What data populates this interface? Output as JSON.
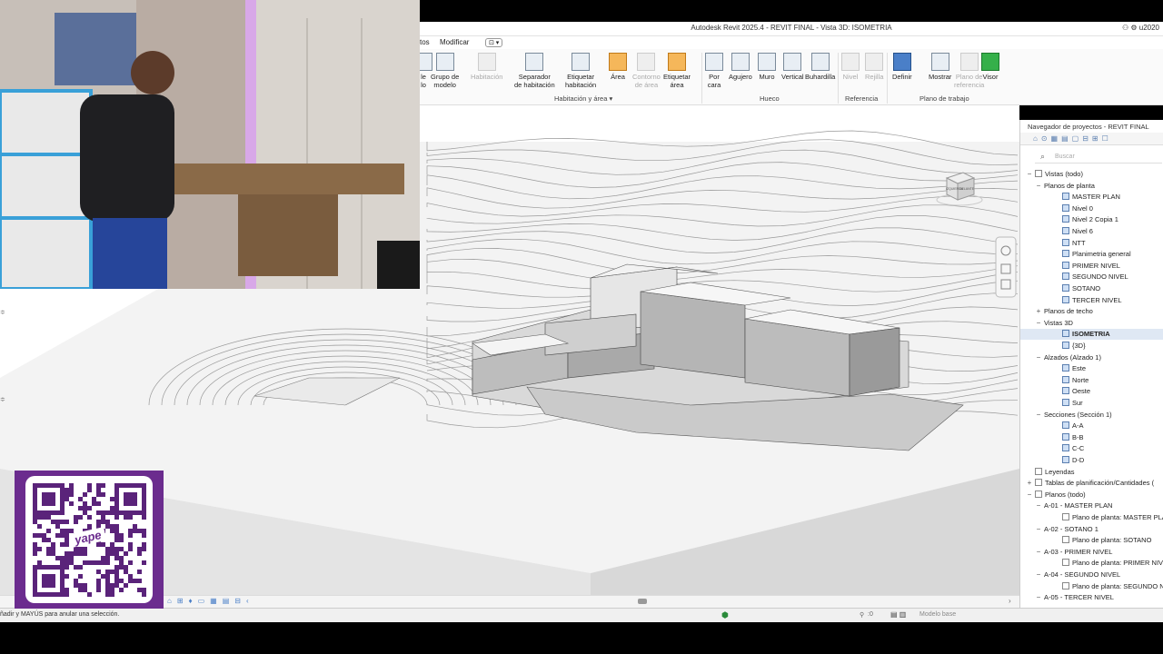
{
  "app": {
    "title": "Autodesk Revit 2025.4 - REVIT FINAL - Vista 3D: ISOMETRIA",
    "user": "u2020"
  },
  "menu": {
    "items": [
      "tos",
      "Modificar"
    ]
  },
  "ribbon": {
    "buttons": [
      {
        "label": "le",
        "label2": "lo",
        "icon": "component-icon",
        "disabled": false
      },
      {
        "label": "Grupo de",
        "label2": "modelo",
        "icon": "model-group-icon",
        "disabled": false
      },
      {
        "label": "Habitación",
        "label2": "",
        "icon": "room-icon",
        "disabled": true
      },
      {
        "label": "Separador",
        "label2": "de habitación",
        "icon": "room-separator-icon",
        "disabled": false
      },
      {
        "label": "Etiquetar",
        "label2": "habitación",
        "icon": "tag-room-icon",
        "disabled": false
      },
      {
        "label": "Área",
        "label2": "",
        "icon": "area-icon",
        "disabled": false
      },
      {
        "label": "Contorno",
        "label2": "de área",
        "icon": "area-boundary-icon",
        "disabled": true
      },
      {
        "label": "Etiquetar",
        "label2": "área",
        "icon": "tag-area-icon",
        "disabled": false
      },
      {
        "label": "Por",
        "label2": "cara",
        "icon": "by-face-icon",
        "disabled": false
      },
      {
        "label": "Agujero",
        "label2": "",
        "icon": "shaft-icon",
        "disabled": false
      },
      {
        "label": "Muro",
        "label2": "",
        "icon": "wall-opening-icon",
        "disabled": false
      },
      {
        "label": "Vertical",
        "label2": "",
        "icon": "vertical-opening-icon",
        "disabled": false
      },
      {
        "label": "Buhardilla",
        "label2": "",
        "icon": "dormer-icon",
        "disabled": false
      },
      {
        "label": "Nivel",
        "label2": "",
        "icon": "level-icon",
        "disabled": true
      },
      {
        "label": "Rejilla",
        "label2": "",
        "icon": "grid-icon",
        "disabled": true
      },
      {
        "label": "Definir",
        "label2": "",
        "icon": "set-workplane-icon",
        "disabled": false
      },
      {
        "label": "Mostrar",
        "label2": "",
        "icon": "show-workplane-icon",
        "disabled": false
      },
      {
        "label": "Plano de",
        "label2": "referencia",
        "icon": "ref-plane-icon",
        "disabled": true
      },
      {
        "label": "Visor",
        "label2": "",
        "icon": "viewer-icon",
        "disabled": false
      }
    ],
    "groups": [
      "Habitación y área ▾",
      "Hueco",
      "Referencia",
      "Plano de trabajo"
    ]
  },
  "viewcube": {
    "left": "IZQUIERDA",
    "front": "DELANTE"
  },
  "project_browser": {
    "title": "Navegador de proyectos - REVIT FINAL",
    "search_placeholder": "Buscar",
    "tree": [
      {
        "label": "Vistas (todo)",
        "toggle": "−",
        "kind": "root"
      },
      {
        "label": "Planos de planta",
        "toggle": "−",
        "kind": "group"
      },
      {
        "label": "MASTER PLAN",
        "kind": "view"
      },
      {
        "label": "Nivel 0",
        "kind": "view"
      },
      {
        "label": "Nivel 2 Copia 1",
        "kind": "view"
      },
      {
        "label": "Nivel 6",
        "kind": "view"
      },
      {
        "label": "NTT",
        "kind": "view"
      },
      {
        "label": "Planimetria general",
        "kind": "view"
      },
      {
        "label": "PRIMER NIVEL",
        "kind": "view"
      },
      {
        "label": "SEGUNDO NIVEL",
        "kind": "view"
      },
      {
        "label": "SOTANO",
        "kind": "view"
      },
      {
        "label": "TERCER NIVEL",
        "kind": "view"
      },
      {
        "label": "Planos de techo",
        "toggle": "+",
        "kind": "group"
      },
      {
        "label": "Vistas 3D",
        "toggle": "−",
        "kind": "group"
      },
      {
        "label": "ISOMETRIA",
        "kind": "view",
        "selected": true
      },
      {
        "label": "{3D}",
        "kind": "view"
      },
      {
        "label": "Alzados (Alzado 1)",
        "toggle": "−",
        "kind": "group"
      },
      {
        "label": "Este",
        "kind": "view"
      },
      {
        "label": "Norte",
        "kind": "view"
      },
      {
        "label": "Oeste",
        "kind": "view"
      },
      {
        "label": "Sur",
        "kind": "view"
      },
      {
        "label": "Secciones (Sección 1)",
        "toggle": "−",
        "kind": "group"
      },
      {
        "label": "A-A",
        "kind": "view"
      },
      {
        "label": "B-B",
        "kind": "view"
      },
      {
        "label": "C-C",
        "kind": "view"
      },
      {
        "label": "D-D",
        "kind": "view"
      },
      {
        "label": "Leyendas",
        "kind": "root"
      },
      {
        "label": "Tablas de planificación/Cantidades (",
        "toggle": "+",
        "kind": "root"
      },
      {
        "label": "Planos (todo)",
        "toggle": "−",
        "kind": "root"
      },
      {
        "label": "A-01 - MASTER PLAN",
        "toggle": "−",
        "kind": "group"
      },
      {
        "label": "Plano de planta: MASTER PLA",
        "kind": "sheetview"
      },
      {
        "label": "A-02 - SOTANO 1",
        "toggle": "−",
        "kind": "group"
      },
      {
        "label": "Plano de planta: SOTANO",
        "kind": "sheetview"
      },
      {
        "label": "A-03 - PRIMER NIVEL",
        "toggle": "−",
        "kind": "group"
      },
      {
        "label": "Plano de planta: PRIMER NIVE",
        "kind": "sheetview"
      },
      {
        "label": "A-04 - SEGUNDO NIVEL",
        "toggle": "−",
        "kind": "group"
      },
      {
        "label": "Plano de planta: SEGUNDO N",
        "kind": "sheetview"
      },
      {
        "label": "A-05 - TERCER NIVEL",
        "toggle": "−",
        "kind": "group"
      }
    ]
  },
  "status": {
    "hint": "ñadir y MAYÚS para anular una selección.",
    "zoom": ":0",
    "model": "Modelo base"
  },
  "qr": {
    "brand": "yape"
  }
}
